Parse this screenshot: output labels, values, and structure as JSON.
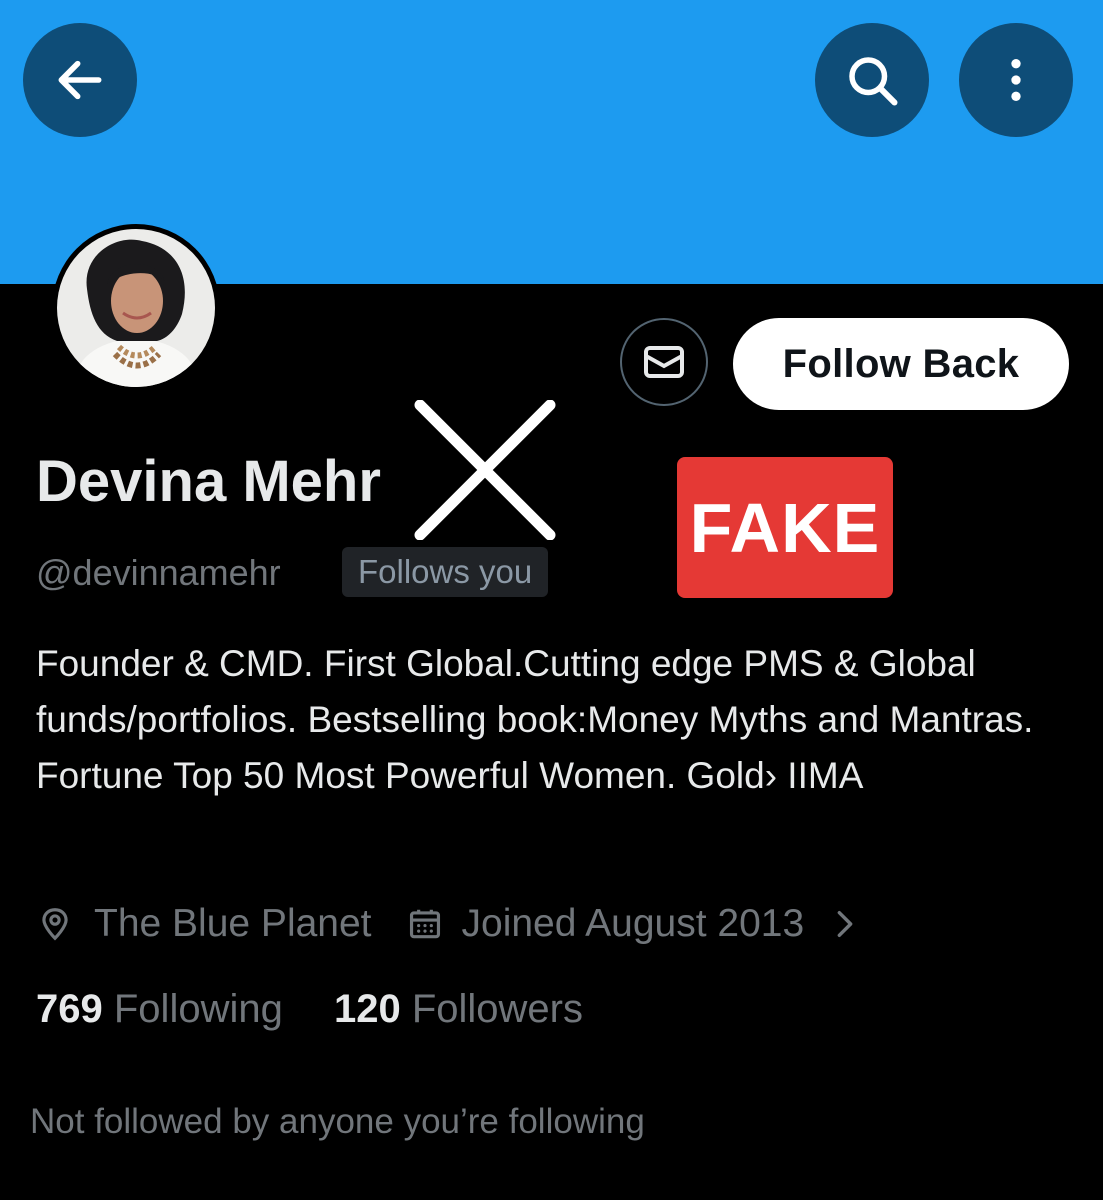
{
  "header": {
    "back_icon": "arrow-left-icon",
    "search_icon": "search-icon",
    "more_icon": "more-vertical-icon",
    "banner_color": "#1d9bf0"
  },
  "profile": {
    "name": "Devina Mehr",
    "handle": "@devinnamehr",
    "follows_you_label": "Follows you",
    "bio": "Founder & CMD. First Global.Cutting edge PMS & Global funds/portfolios. Bestselling book:Money Myths and Mantras. Fortune Top 50 Most Powerful Women. Gold› IIMA",
    "location": "The Blue Planet",
    "joined": "Joined August 2013",
    "following_count": "769",
    "following_label": "Following",
    "followers_count": "120",
    "followers_label": "Followers",
    "not_followed_text": "Not followed by anyone you’re following"
  },
  "actions": {
    "message_icon": "envelope-icon",
    "follow_back_label": "Follow Back"
  },
  "overlay": {
    "fake_label": "FAKE",
    "fake_color": "#e53935"
  }
}
